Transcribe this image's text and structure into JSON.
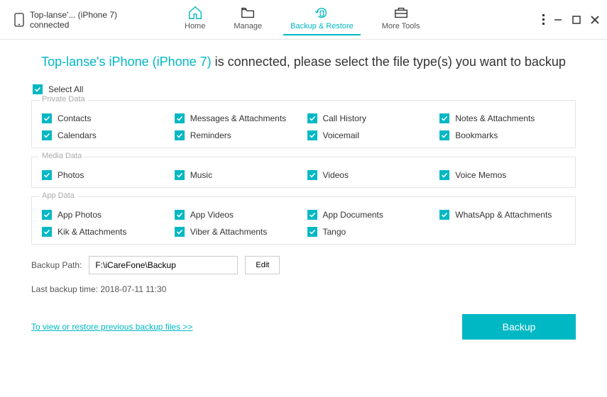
{
  "device": {
    "name": "Top-lanse'... (iPhone 7)",
    "status": "connected"
  },
  "tabs": {
    "home": "Home",
    "manage": "Manage",
    "backup": "Backup & Restore",
    "tools": "More Tools"
  },
  "headline": {
    "device": "Top-lanse's iPhone (iPhone 7)",
    "rest": " is connected, please select the file type(s) you want to backup"
  },
  "selectAll": "Select All",
  "groups": {
    "private": {
      "title": "Private Data",
      "items": [
        "Contacts",
        "Messages & Attachments",
        "Call History",
        "Notes & Attachments",
        "Calendars",
        "Reminders",
        "Voicemail",
        "Bookmarks"
      ]
    },
    "media": {
      "title": "Media Data",
      "items": [
        "Photos",
        "Music",
        "Videos",
        "Voice Memos"
      ]
    },
    "app": {
      "title": "App Data",
      "items": [
        "App Photos",
        "App Videos",
        "App Documents",
        "WhatsApp & Attachments",
        "Kik & Attachments",
        "Viber & Attachments",
        "Tango"
      ]
    }
  },
  "backupPath": {
    "label": "Backup Path:",
    "value": "F:\\iCareFone\\Backup",
    "edit": "Edit"
  },
  "lastBackup": "Last backup time: 2018-07-11 11:30",
  "restoreLink": "To view or restore previous backup files >>",
  "backupBtn": "Backup"
}
